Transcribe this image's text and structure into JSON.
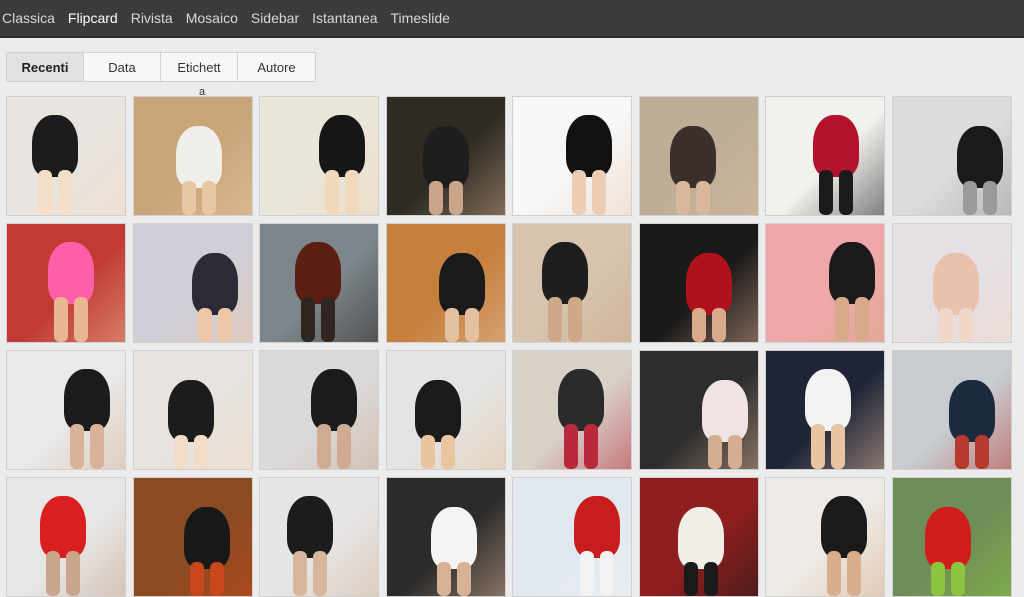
{
  "topbar": {
    "views": [
      {
        "label": "Classica",
        "active": false
      },
      {
        "label": "Flipcard",
        "active": true
      },
      {
        "label": "Rivista",
        "active": false
      },
      {
        "label": "Mosaico",
        "active": false
      },
      {
        "label": "Sidebar",
        "active": false
      },
      {
        "label": "Istantanea",
        "active": false
      },
      {
        "label": "Timeslide",
        "active": false
      }
    ]
  },
  "tabs": [
    {
      "label": "Recenti",
      "active": true
    },
    {
      "label": "Data",
      "active": false
    },
    {
      "label": "Etichett",
      "active": false
    },
    {
      "label": "Autore",
      "active": false
    }
  ],
  "stray_text": "a",
  "thumbnails": [
    [
      "#e8e4df",
      "#1c1c1c",
      "#f4ddc9"
    ],
    [
      "#c9a57a",
      "#f1efe9",
      "#e9c7a5"
    ],
    [
      "#e9e6da",
      "#161616",
      "#f0d9bd"
    ],
    [
      "#2e2b22",
      "#1e1e1e",
      "#caa58a"
    ],
    [
      "#f7f7f7",
      "#111111",
      "#edcdb4"
    ],
    [
      "#bfae97",
      "#3a2f2a",
      "#d8b89d"
    ],
    [
      "#f3f1ee",
      "#b3132a",
      "#1a1a1a"
    ],
    [
      "#dcdcdc",
      "#1a1a1a",
      "#9a9a9a"
    ],
    [
      "#c13a35",
      "#ff5fa8",
      "#e9b794"
    ],
    [
      "#cfcfd8",
      "#2b2b36",
      "#ecc6a6"
    ],
    [
      "#7d868b",
      "#5b1e12",
      "#2f2622"
    ],
    [
      "#c77f3d",
      "#1a1a1a",
      "#e2c0a0"
    ],
    [
      "#d6c4ae",
      "#1e1e1e",
      "#cda98a"
    ],
    [
      "#191919",
      "#b0121b",
      "#d9a98c"
    ],
    [
      "#f0a7a9",
      "#1a1a1a",
      "#d7ab8a"
    ],
    [
      "#e4e0e4",
      "#e9c2ae",
      "#f1d7c8"
    ],
    [
      "#e9e9e9",
      "#1b1b1b",
      "#d8b39a"
    ],
    [
      "#e7e3df",
      "#1c1c1c",
      "#f2dcc8"
    ],
    [
      "#dadada",
      "#1b1b1b",
      "#cfab93"
    ],
    [
      "#e4e4e4",
      "#1a1a1a",
      "#e9c49f"
    ],
    [
      "#d9d2c9",
      "#2b2b2b",
      "#b82a3b"
    ],
    [
      "#2d2d2d",
      "#f0e4e4",
      "#d5ae92"
    ],
    [
      "#1f2436",
      "#f3f3f3",
      "#e8c4a3"
    ],
    [
      "#c9cdd2",
      "#1b2a3c",
      "#b63a2e"
    ],
    [
      "#e7e7e7",
      "#d91f1f",
      "#c8a58c"
    ],
    [
      "#8a4b22",
      "#181818",
      "#c9471c"
    ],
    [
      "#e6e6e6",
      "#1c1c1c",
      "#d7b79c"
    ],
    [
      "#2b2b2b",
      "#f4f4f4",
      "#d9b296"
    ],
    [
      "#e1e8ef",
      "#c81d1d",
      "#f2f2f2"
    ],
    [
      "#8f1e1e",
      "#f1ede7",
      "#1a1a1a"
    ],
    [
      "#eeeae6",
      "#1a1a1a",
      "#d8ae8c"
    ],
    [
      "#6f8d58",
      "#d21b1b",
      "#8cc43f"
    ]
  ]
}
